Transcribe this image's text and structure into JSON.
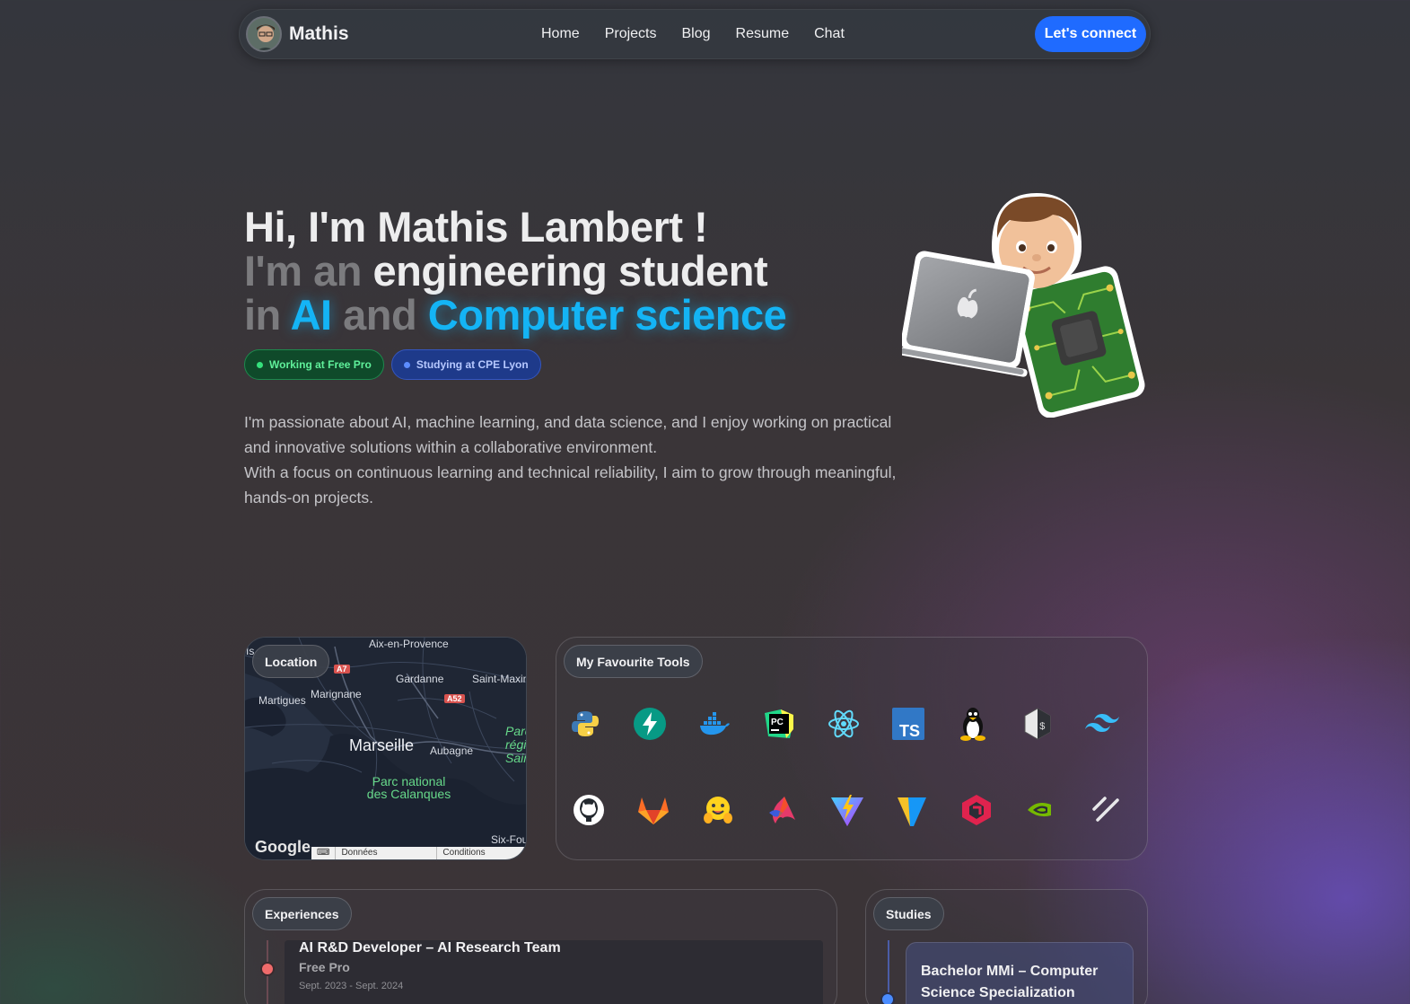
{
  "nav": {
    "brand": "Mathis",
    "links": [
      "Home",
      "Projects",
      "Blog",
      "Resume",
      "Chat"
    ],
    "cta": "Let's connect"
  },
  "hero": {
    "line1": "Hi, I'm Mathis Lambert !",
    "line2_prefix": "I'm an",
    "line2_main": "engineering student",
    "line3_in": "in",
    "line3_ai": "AI",
    "line3_and": "and",
    "line3_cs": "Computer science",
    "badges": [
      {
        "label": "Working at Free Pro",
        "color": "#35e07c"
      },
      {
        "label": "Studying at CPE Lyon",
        "color": "#5c8cff"
      }
    ],
    "intro_p1": "I'm passionate about AI, machine learning, and data science, and I enjoy working on practical and innovative solutions within a collaborative environment.",
    "intro_p2": "With a focus on continuous learning and technical reliability, I aim to grow through meaningful, hands-on projects."
  },
  "location": {
    "title": "Location",
    "places": {
      "aix": "Aix-en-Provence",
      "gardanne": "Gardanne",
      "saintmaxim": "Saint-Maxim",
      "martigues": "Martigues",
      "marignane": "Marignane",
      "marseille": "Marseille",
      "aubagne": "Aubagne",
      "calanques": "Parc national des Calanques",
      "parc_regional": "Parc régio Sain",
      "sixfours": "Six-Fou",
      "ist": "Is"
    },
    "roads": [
      "A7",
      "A52"
    ],
    "google": "Google",
    "footer_links": [
      "Données cartographiques",
      "Conditions d'utilisation"
    ]
  },
  "tools": {
    "title": "My Favourite Tools",
    "items": [
      "python-icon",
      "fastapi-icon",
      "docker-icon",
      "pycharm-icon",
      "react-icon",
      "typescript-icon",
      "linux-icon",
      "bash-icon",
      "tailwind-icon",
      "github-icon",
      "gitlab-icon",
      "huggingface-icon",
      "astro-icon",
      "vite-icon",
      "vuetify-icon",
      "nestjs-icon",
      "nvidia-icon",
      "shadcn-icon"
    ],
    "ts_text": "TS",
    "pc_text": "PC"
  },
  "experiences": {
    "title": "Experiences",
    "items": [
      {
        "role": "AI R&D Developer – AI Research Team",
        "company": "Free Pro",
        "dates": "Sept. 2023 - Sept. 2024"
      }
    ]
  },
  "studies": {
    "title": "Studies",
    "items": [
      {
        "degree": "Bachelor MMi – Computer Science Specialization"
      }
    ]
  },
  "colors": {
    "accent": "#1f6bff",
    "highlight": "#14b4f5",
    "background": "#3a3538"
  }
}
